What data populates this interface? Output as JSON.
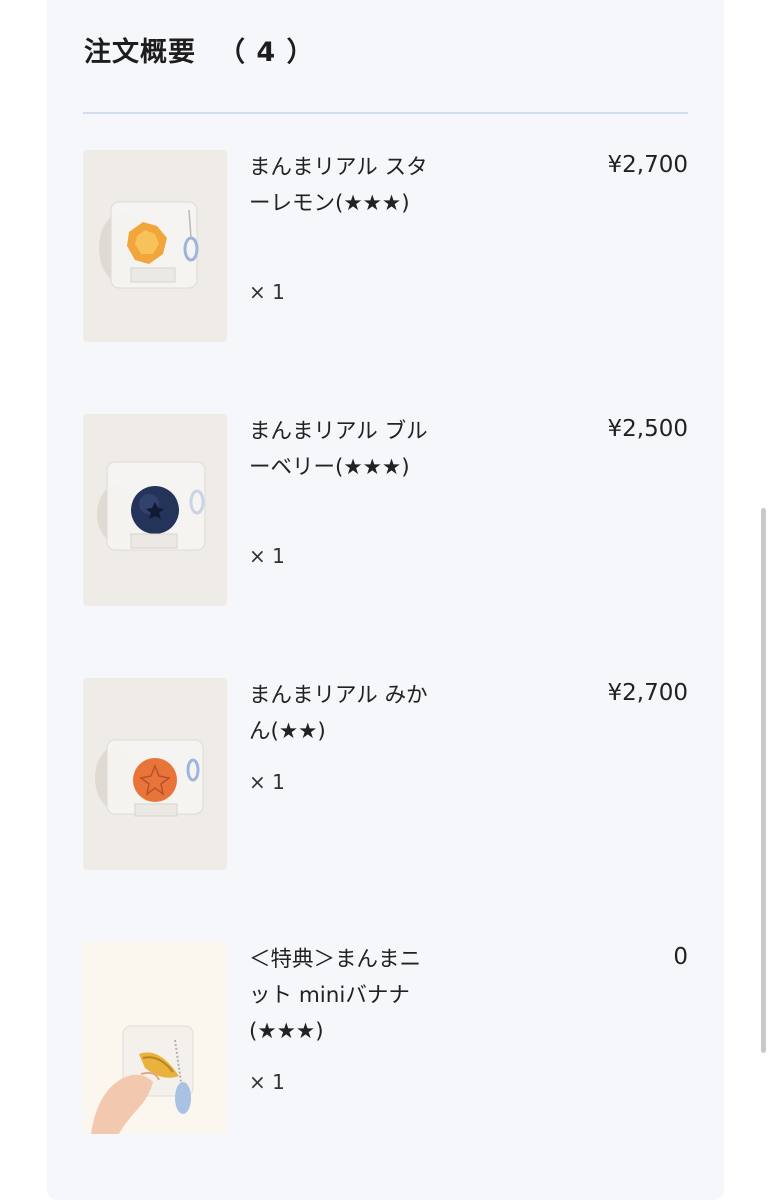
{
  "summary": {
    "title": "注文概要",
    "count": "（ 4 ）"
  },
  "items": [
    {
      "name": "まんまリアル スターレモン(★★★)",
      "quantity": "× 1",
      "price": "¥2,700",
      "image_icon": "star-lemon-keychain",
      "fruit_color": "#f1a53a"
    },
    {
      "name": "まんまリアル ブルーベリー(★★★)",
      "quantity": "× 1",
      "price": "¥2,500",
      "image_icon": "blueberry-keychain",
      "fruit_color": "#23335a"
    },
    {
      "name": "まんまリアル みかん(★★)",
      "quantity": "× 1",
      "price": "¥2,700",
      "image_icon": "mikan-keychain",
      "fruit_color": "#e8743a"
    },
    {
      "name": "＜特典＞まんまニット miniバナナ(★★★)",
      "quantity": "× 1",
      "price": "0",
      "image_icon": "knit-mini-banana-keychain",
      "fruit_color": "#e8b23c"
    }
  ]
}
